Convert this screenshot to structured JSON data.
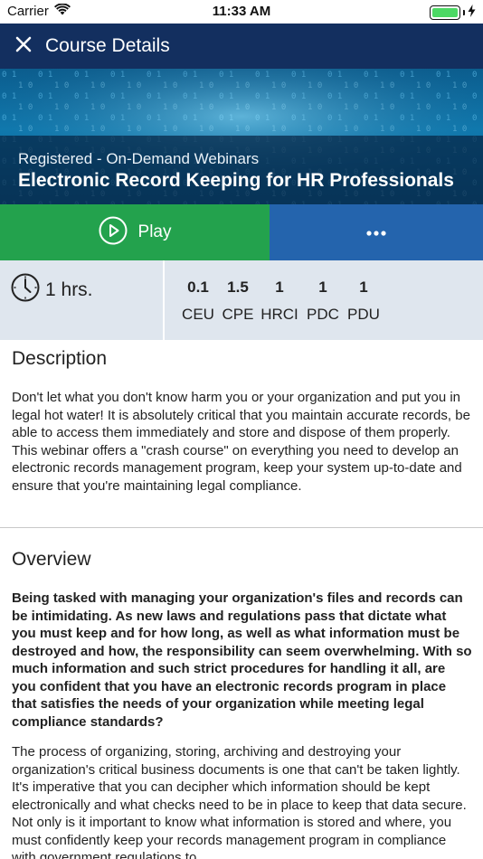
{
  "status_bar": {
    "carrier": "Carrier",
    "time": "11:33 AM",
    "icons": [
      "wifi-icon",
      "battery-icon",
      "charging-bolt-icon"
    ]
  },
  "header": {
    "title": "Course Details",
    "close_icon": "close-icon"
  },
  "hero": {
    "subtitle": "Registered - On-Demand Webinars",
    "title": "Electronic Record Keeping for HR Professionals"
  },
  "actions": {
    "play_label": "Play",
    "play_icon": "play-circle-icon",
    "more_icon": "more-dots-icon",
    "play_color": "#23a24d",
    "more_color": "#2464ad"
  },
  "credits": {
    "duration": "1 hrs.",
    "duration_icon": "clock-icon",
    "items": [
      {
        "value": "0.1",
        "label": "CEU"
      },
      {
        "value": "1.5",
        "label": "CPE"
      },
      {
        "value": "1",
        "label": "HRCI"
      },
      {
        "value": "1",
        "label": "PDC"
      },
      {
        "value": "1",
        "label": "PDU"
      }
    ]
  },
  "description": {
    "heading": "Description",
    "text": "Don't let what you don't know harm you or your organization and put you in legal hot water! It is absolutely critical that you maintain accurate records, be able to access them immediately and store and dispose of them properly. This webinar offers a \"crash course\" on everything you need to develop an electronic records management program, keep your system up-to-date and ensure that you're maintaining legal compliance."
  },
  "overview": {
    "heading": "Overview",
    "intro": "Being tasked with managing your organization's files and records can be intimidating. As new laws and regulations pass that dictate what you must keep and for how long, as well as what information must be destroyed and how, the responsibility can seem overwhelming. With so much information and such strict procedures for handling it all, are you confident that you have an electronic records program in place that satisfies the needs of your organization while meeting legal compliance standards?",
    "body": "The process of organizing, storing, archiving and destroying your organization's critical business documents is one that can't be taken lightly. It's imperative that you can decipher which information should be kept electronically and what checks need to be in place to keep that data secure. Not only is it important to know what information is stored and where, you must confidently keep your records management program in compliance with government regulations to"
  }
}
